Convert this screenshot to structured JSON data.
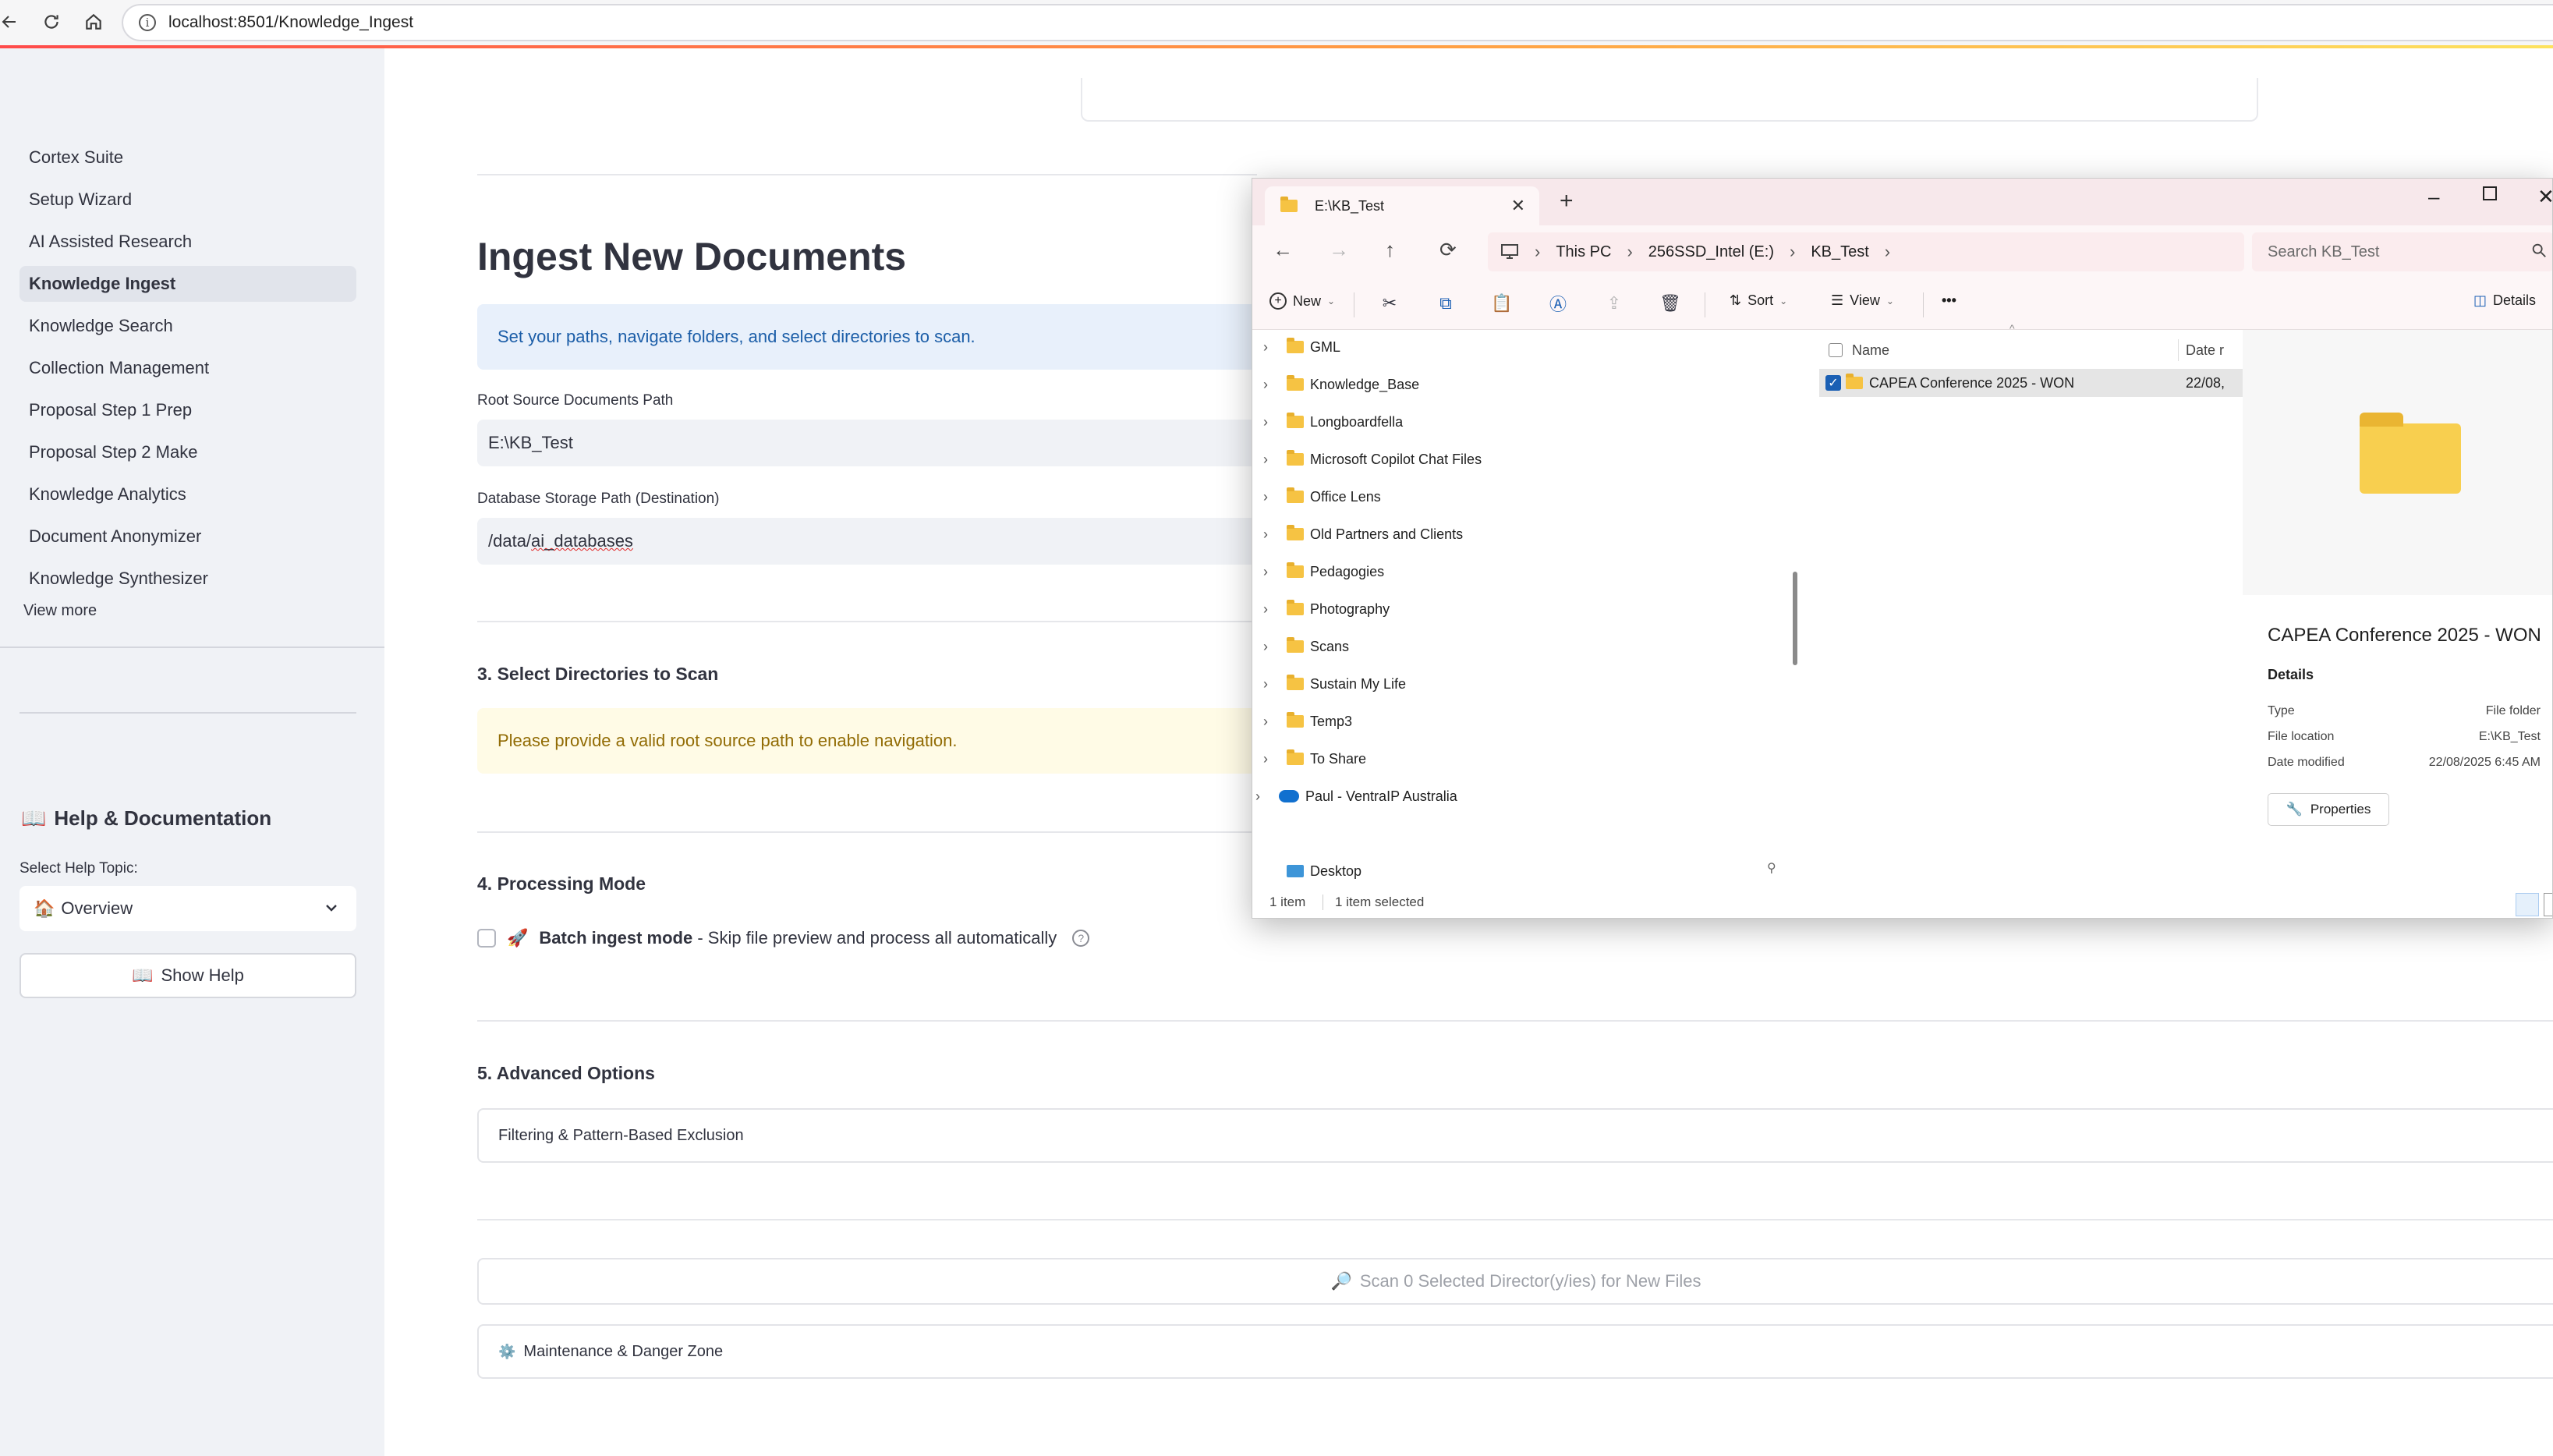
{
  "browser": {
    "url": "localhost:8501/Knowledge_Ingest",
    "back_icon": "arrow-left",
    "reload_icon": "refresh",
    "home_icon": "home"
  },
  "sidebar": {
    "items": [
      {
        "label": "Cortex Suite",
        "active": false
      },
      {
        "label": "Setup Wizard",
        "active": false
      },
      {
        "label": "AI Assisted Research",
        "active": false
      },
      {
        "label": "Knowledge Ingest",
        "active": true
      },
      {
        "label": "Knowledge Search",
        "active": false
      },
      {
        "label": "Collection Management",
        "active": false
      },
      {
        "label": "Proposal Step 1 Prep",
        "active": false
      },
      {
        "label": "Proposal Step 2 Make",
        "active": false
      },
      {
        "label": "Knowledge Analytics",
        "active": false
      },
      {
        "label": "Document Anonymizer",
        "active": false
      },
      {
        "label": "Knowledge Synthesizer",
        "active": false
      }
    ],
    "view_more": "View more",
    "help": {
      "title_icon": "📖",
      "title": "Help & Documentation",
      "select_label": "Select Help Topic:",
      "select_icon": "🏠",
      "select_value": "Overview",
      "button_icon": "📖",
      "button_label": "Show Help"
    }
  },
  "main": {
    "title": "Ingest New Documents",
    "info_text": "Set your paths, navigate folders, and select directories to scan.",
    "root_label": "Root Source Documents Path",
    "root_value": "E:\\KB_Test",
    "db_label": "Database Storage Path (Destination)",
    "db_value_prefix": "/data/",
    "db_value_squiggle": "ai_databases",
    "section3": "3. Select Directories to Scan",
    "warning_text": "Please provide a valid root source path to enable navigation.",
    "section4": "4. Processing Mode",
    "batch_icon": "🚀",
    "batch_bold": "Batch ingest mode",
    "batch_rest": " - Skip file preview and process all automatically",
    "section5": "5. Advanced Options",
    "filter_expander": "Filtering & Pattern-Based Exclusion",
    "scan_icon": "🔎",
    "scan_button": "Scan 0 Selected Director(y/ies) for New Files",
    "maint_icon": "⚙️",
    "maint_expander": "Maintenance & Danger Zone"
  },
  "explorer": {
    "tab_title": "E:\\KB_Test",
    "breadcrumbs": [
      "This PC",
      "256SSD_Intel (E:)",
      "KB_Test"
    ],
    "search_placeholder": "Search KB_Test",
    "toolbar": {
      "new": "New",
      "sort": "Sort",
      "view": "View",
      "more": "•••",
      "details": "Details"
    },
    "tree": [
      {
        "label": "GML",
        "type": "folder"
      },
      {
        "label": "Knowledge_Base",
        "type": "folder"
      },
      {
        "label": "Longboardfella",
        "type": "folder"
      },
      {
        "label": "Microsoft Copilot Chat Files",
        "type": "folder"
      },
      {
        "label": "Office Lens",
        "type": "folder"
      },
      {
        "label": "Old Partners and Clients",
        "type": "folder"
      },
      {
        "label": "Pedagogies",
        "type": "folder"
      },
      {
        "label": "Photography",
        "type": "folder"
      },
      {
        "label": "Scans",
        "type": "folder"
      },
      {
        "label": "Sustain My Life",
        "type": "folder"
      },
      {
        "label": "Temp3",
        "type": "folder"
      },
      {
        "label": "To Share",
        "type": "folder"
      },
      {
        "label": "Paul - VentraIP Australia",
        "type": "cloud"
      }
    ],
    "desktop": "Desktop",
    "list_header_name": "Name",
    "list_header_date": "Date r",
    "list_item_name": "CAPEA Conference 2025 - WON",
    "list_item_date": "22/08,",
    "details": {
      "title": "CAPEA Conference 2025 - WON",
      "subtitle": "Details",
      "rows": [
        {
          "key": "Type",
          "value": "File folder"
        },
        {
          "key": "File location",
          "value": "E:\\KB_Test"
        },
        {
          "key": "Date modified",
          "value": "22/08/2025 6:45 AM"
        }
      ],
      "properties": "Properties"
    },
    "status_count": "1 item",
    "status_selected": "1 item selected"
  }
}
